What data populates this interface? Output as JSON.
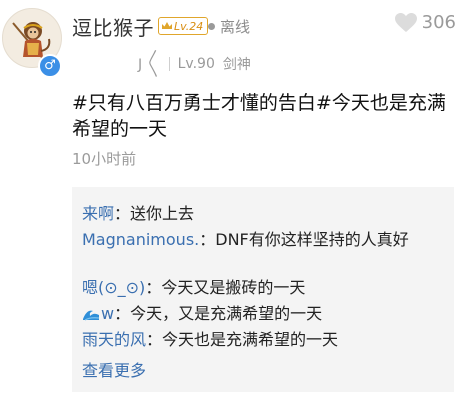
{
  "post": {
    "user": {
      "name": "逗比猴子",
      "vip_level": "Lv.24",
      "status": "离线",
      "tag": "J 〳〵",
      "level": "Lv.90",
      "class": "剑神",
      "gender_symbol": "♂"
    },
    "likes": "306",
    "content": "#只有八百万勇士才懂的告白#今天也是充满希望的一天",
    "time": "10小时前",
    "comments": [
      {
        "user": "来啊",
        "sep": "：",
        "text": "送你上去"
      },
      {
        "user": "Magnanimous.",
        "sep": "：",
        "text": "DNF有你这样坚持的人真好"
      },
      {
        "user": "嗯(⊙_⊙)",
        "sep": "：",
        "text": "今天又是搬砖的一天"
      },
      {
        "user": "w",
        "sep": "：",
        "text": "今天，又是充满希望的一天"
      },
      {
        "user": "雨天的风",
        "sep": "：",
        "text": "今天也是充满希望的一天"
      }
    ],
    "see_more": "查看更多"
  },
  "colors": {
    "link_blue": "#3a6fb0",
    "vip_gold": "#e0a62c",
    "gender_blue": "#3b8fe6",
    "muted_gray": "#9a9a9a",
    "comment_bg": "#f4f4f4"
  },
  "icons": {
    "heart": "heart-icon",
    "vip": "crown-icon",
    "gender": "male-icon",
    "wave": "wave-icon"
  }
}
